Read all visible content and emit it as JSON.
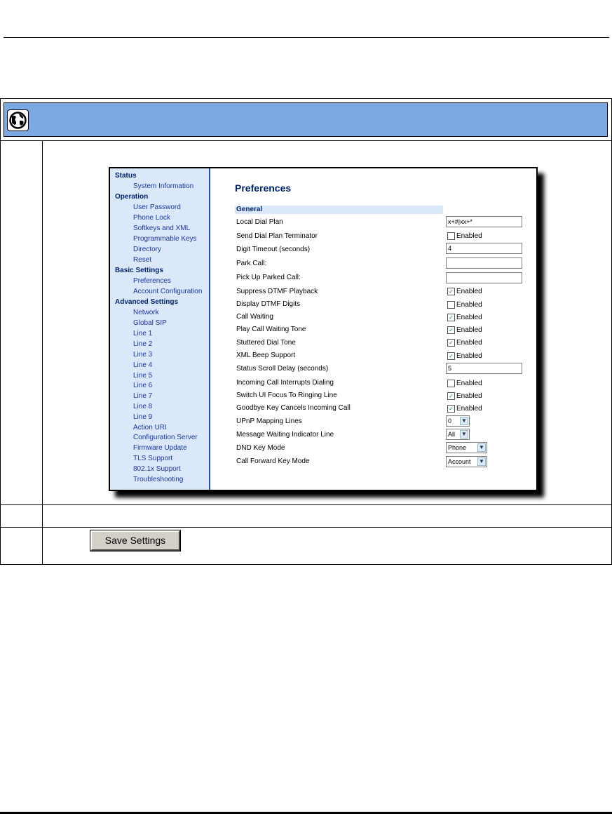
{
  "window": {
    "page_title": "Preferences",
    "section_title": "General"
  },
  "sidebar": {
    "groups": [
      {
        "title": "Status",
        "items": [
          "System Information"
        ]
      },
      {
        "title": "Operation",
        "items": [
          "User Password",
          "Phone Lock",
          "Softkeys and XML",
          "Programmable Keys",
          "Directory",
          "Reset"
        ]
      },
      {
        "title": "Basic Settings",
        "items": [
          "Preferences",
          "Account Configuration"
        ]
      },
      {
        "title": "Advanced Settings",
        "items": [
          "Network",
          "Global SIP",
          "Line 1",
          "Line 2",
          "Line 3",
          "Line 4",
          "Line 5",
          "Line 6",
          "Line 7",
          "Line 8",
          "Line 9",
          "Action URI",
          "Configuration Server",
          "Firmware Update",
          "TLS Support",
          "802.1x Support",
          "Troubleshooting"
        ]
      }
    ]
  },
  "settings": {
    "local_dial_plan": {
      "label": "Local Dial Plan",
      "value": "x+#|xx+*"
    },
    "send_dial_plan_terminator": {
      "label": "Send Dial Plan Terminator",
      "checked": false,
      "option": "Enabled"
    },
    "digit_timeout": {
      "label": "Digit Timeout (seconds)",
      "value": "4"
    },
    "park_call": {
      "label": "Park Call:",
      "value": ""
    },
    "pick_up_parked_call": {
      "label": "Pick Up Parked Call:",
      "value": ""
    },
    "suppress_dtmf_playback": {
      "label": "Suppress DTMF Playback",
      "checked": true,
      "option": "Enabled"
    },
    "display_dtmf_digits": {
      "label": "Display DTMF Digits",
      "checked": false,
      "option": "Enabled"
    },
    "call_waiting": {
      "label": "Call Waiting",
      "checked": true,
      "option": "Enabled"
    },
    "play_call_waiting_tone": {
      "label": "Play Call Waiting Tone",
      "checked": true,
      "option": "Enabled"
    },
    "stuttered_dial_tone": {
      "label": "Stuttered Dial Tone",
      "checked": true,
      "option": "Enabled"
    },
    "xml_beep_support": {
      "label": "XML Beep Support",
      "checked": true,
      "option": "Enabled"
    },
    "status_scroll_delay": {
      "label": "Status Scroll Delay (seconds)",
      "value": "5"
    },
    "incoming_call_interrupts_dialing": {
      "label": "Incoming Call Interrupts Dialing",
      "checked": false,
      "option": "Enabled"
    },
    "switch_ui_focus": {
      "label": "Switch UI Focus To Ringing Line",
      "checked": true,
      "option": "Enabled"
    },
    "goodbye_key_cancels": {
      "label": "Goodbye Key Cancels Incoming Call",
      "checked": true,
      "option": "Enabled"
    },
    "upnp_mapping_lines": {
      "label": "UPnP Mapping Lines",
      "selected": "0"
    },
    "mwi_line": {
      "label": "Message Waiting Indicator Line",
      "selected": "All"
    },
    "dnd_key_mode": {
      "label": "DND Key Mode",
      "selected": "Phone"
    },
    "call_forward_key_mode": {
      "label": "Call Forward Key Mode",
      "selected": "Account"
    }
  },
  "actions": {
    "save_label": "Save Settings"
  },
  "colors": {
    "header_bar": "#7aa9e3",
    "sidebar_bg": "#dbe8fa",
    "link": "#1a36a0",
    "heading": "#00236b"
  },
  "icons": {
    "header": "globe-icon",
    "checkbox_mark": "check-icon",
    "dropdown": "chevron-down-icon"
  }
}
